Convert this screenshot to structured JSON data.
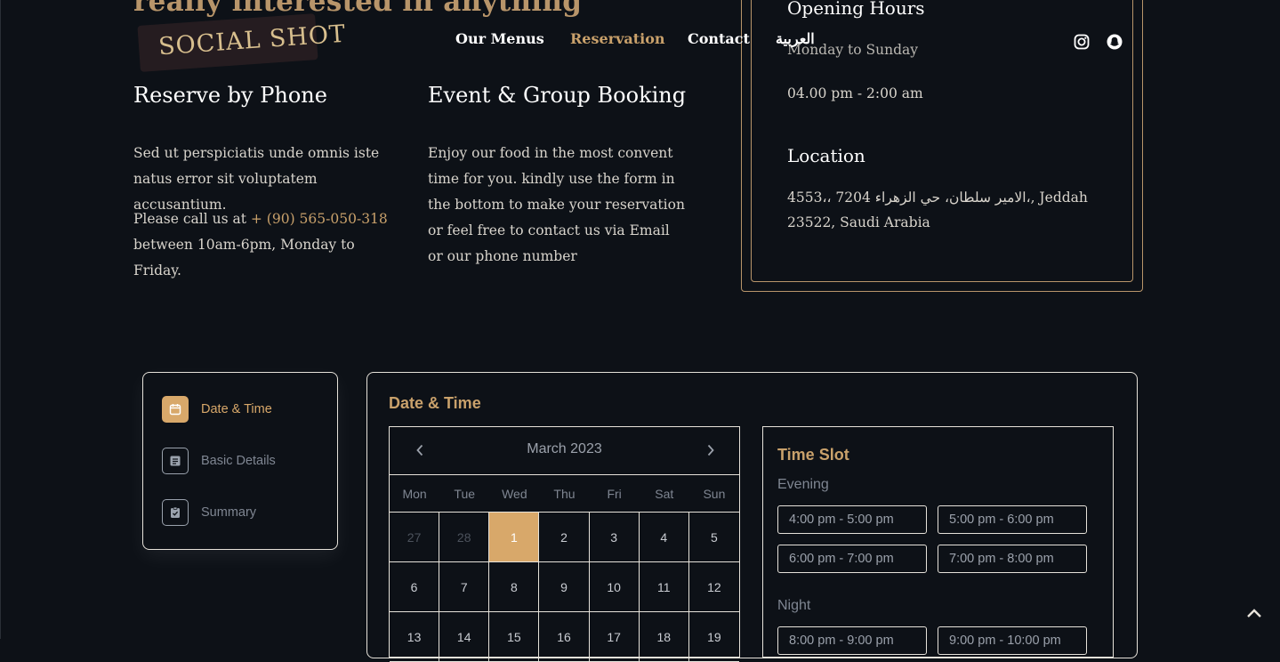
{
  "hero": {
    "heading_partial": "really interested in anything"
  },
  "header": {
    "logo_text": "SOCIAL SHOT",
    "nav": [
      "Our Menus",
      "Reservation",
      "Contact",
      "العربية"
    ],
    "icons": [
      "instagram-icon",
      "snapchat-icon"
    ]
  },
  "phone": {
    "title": "Reserve by Phone",
    "text": "Sed ut perspiciatis unde omnis iste natus error sit voluptatem accusantium.",
    "call_prefix": "Please call us at ",
    "phone_number": "+ (90) 565-050-318",
    "call_suffix": "between 10am-6pm, Monday to Friday."
  },
  "event": {
    "title": "Event & Group Booking",
    "text": "Enjoy our food in the most convent time for you. kindly use the form in the bottom to make your reservation or feel free to contact us via Email or our phone number"
  },
  "hours": {
    "title": "Opening Hours",
    "days": "Monday to Sunday",
    "time": "04.00 pm - 2:00 am",
    "location_title": "Location",
    "address": "4553،، 7204 الامير سلطان، حي الزهراء،, Jeddah 23522, Saudi Arabia"
  },
  "stepper": {
    "steps": [
      {
        "label": "Date & Time",
        "icon": "calendar-icon",
        "active": true
      },
      {
        "label": "Basic Details",
        "icon": "document-icon",
        "active": false
      },
      {
        "label": "Summary",
        "icon": "clipboard-check-icon",
        "active": false
      }
    ]
  },
  "booking": {
    "title": "Date & Time",
    "calendar": {
      "month": "March 2023",
      "weekdays": [
        "Mon",
        "Tue",
        "Wed",
        "Thu",
        "Fri",
        "Sat",
        "Sun"
      ],
      "days": [
        {
          "d": "27",
          "muted": true
        },
        {
          "d": "28",
          "muted": true
        },
        {
          "d": "1",
          "selected": true
        },
        {
          "d": "2"
        },
        {
          "d": "3"
        },
        {
          "d": "4"
        },
        {
          "d": "5"
        },
        {
          "d": "6"
        },
        {
          "d": "7"
        },
        {
          "d": "8"
        },
        {
          "d": "9"
        },
        {
          "d": "10"
        },
        {
          "d": "11"
        },
        {
          "d": "12"
        },
        {
          "d": "13"
        },
        {
          "d": "14"
        },
        {
          "d": "15"
        },
        {
          "d": "16"
        },
        {
          "d": "17"
        },
        {
          "d": "18"
        },
        {
          "d": "19"
        }
      ]
    },
    "timeslot": {
      "title": "Time Slot",
      "evening_label": "Evening",
      "evening": [
        "4:00 pm - 5:00 pm",
        "5:00 pm - 6:00 pm",
        "6:00 pm - 7:00 pm",
        "7:00 pm - 8:00 pm"
      ],
      "night_label": "Night",
      "night": [
        "8:00 pm - 9:00 pm",
        "9:00 pm - 10:00 pm"
      ]
    }
  },
  "colors": {
    "accent": "#c9a16b",
    "background": "#0d1117",
    "selected_day": "#d8a86a"
  }
}
